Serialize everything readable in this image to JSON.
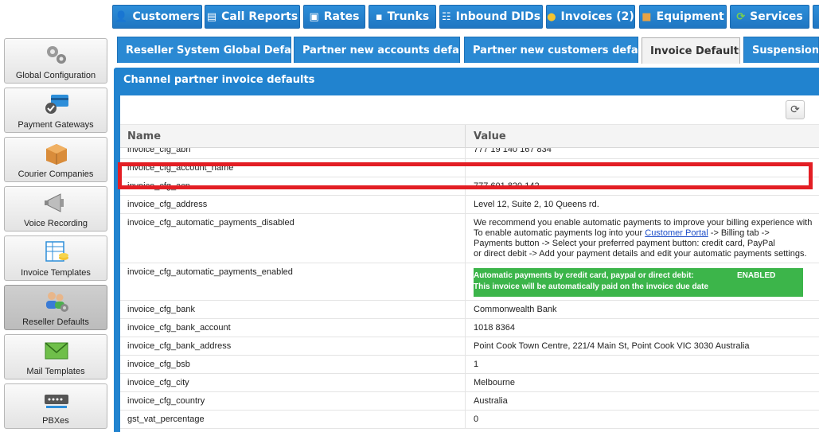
{
  "topnav": {
    "tabs": [
      {
        "label": "Customers",
        "icon": "person-icon"
      },
      {
        "label": "Call Reports",
        "icon": "report-icon"
      },
      {
        "label": "Rates",
        "icon": "chart-icon"
      },
      {
        "label": "Trunks",
        "icon": "trunk-icon"
      },
      {
        "label": "Inbound DIDs",
        "icon": "did-icon"
      },
      {
        "label": "Invoices (2)",
        "icon": "coins-icon"
      },
      {
        "label": "Equipment",
        "icon": "box-icon"
      },
      {
        "label": "Services",
        "icon": "refresh-icon"
      }
    ]
  },
  "sidebar": {
    "items": [
      {
        "label": "Global Configuration",
        "icon": "gears-icon"
      },
      {
        "label": "Payment Gateways",
        "icon": "card-icon"
      },
      {
        "label": "Courier Companies",
        "icon": "parcel-icon"
      },
      {
        "label": "Voice Recording",
        "icon": "megaphone-icon"
      },
      {
        "label": "Invoice Templates",
        "icon": "template-icon"
      },
      {
        "label": "Reseller Defaults",
        "icon": "users-gear-icon"
      },
      {
        "label": "Mail Templates",
        "icon": "envelope-icon"
      },
      {
        "label": "PBXes",
        "icon": "pbx-icon"
      }
    ],
    "active_index": 5
  },
  "subtabs": {
    "tabs": [
      {
        "label": "Reseller System Global Defaults"
      },
      {
        "label": "Partner new accounts defaults"
      },
      {
        "label": "Partner new customers defaults"
      },
      {
        "label": "Invoice Defaults"
      },
      {
        "label": "Suspension a"
      }
    ],
    "active_index": 3
  },
  "panel": {
    "title": "Channel partner invoice defaults",
    "refresh_icon": "refresh-icon"
  },
  "grid": {
    "columns": [
      "Name",
      "Value"
    ],
    "rows": [
      {
        "name": "invoice_cfg_abn",
        "value": "777 19 140 167 834"
      },
      {
        "name": "invoice_cfg_account_name",
        "value": ""
      },
      {
        "name": "invoice_cfg_acn",
        "value": "777 601 820 142"
      },
      {
        "name": "invoice_cfg_address",
        "value": "Level 12, Suite 2, 10 Queens rd."
      },
      {
        "name": "invoice_cfg_automatic_payments_disabled",
        "value_lines": {
          "l1": "We recommend you enable automatic payments to improve your billing experience with",
          "l2_pre": "To enable automatic payments log into your ",
          "l2_link": "Customer Portal",
          "l2_post": " -> Billing tab ->",
          "l3": "Payments button -> Select your preferred payment button: credit card, PayPal",
          "l4": "or direct debit -> Add your payment details and edit your automatic payments settings."
        }
      },
      {
        "name": "invoice_cfg_automatic_payments_enabled",
        "banner": {
          "line1": "Automatic payments by credit card, paypal or direct debit:",
          "status": "ENABLED",
          "line2": "This invoice will be automatically paid on the invoice due date"
        }
      },
      {
        "name": "invoice_cfg_bank",
        "value": "Commonwealth Bank"
      },
      {
        "name": "invoice_cfg_bank_account",
        "value": "1018 8364"
      },
      {
        "name": "invoice_cfg_bank_address",
        "value": "Point Cook Town Centre, 221/4 Main St, Point Cook VIC 3030 Australia"
      },
      {
        "name": "invoice_cfg_bsb",
        "value": "1"
      },
      {
        "name": "invoice_cfg_city",
        "value": "Melbourne"
      },
      {
        "name": "invoice_cfg_country",
        "value": "Australia"
      },
      {
        "name": "gst_vat_percentage",
        "value": "0"
      }
    ]
  },
  "colors": {
    "nav_blue": "#2183cf",
    "enabled_green": "#3cb54a",
    "highlight_red": "#e31e24",
    "link_blue": "#1f4fc9"
  }
}
